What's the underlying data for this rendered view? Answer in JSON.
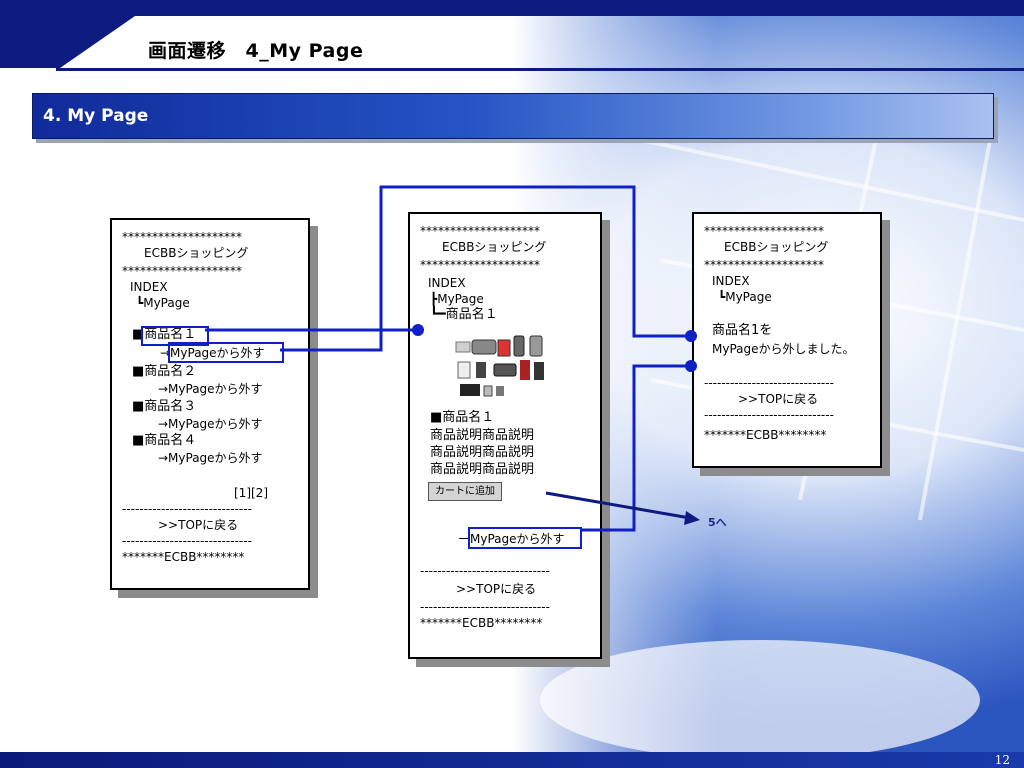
{
  "slide": {
    "title": "画面遷移　4_My Page",
    "section_title": "4. My Page",
    "page_number": "12"
  },
  "screen1": {
    "lines": [
      "********************",
      "ECBBショッピング",
      "********************",
      "INDEX",
      "┗MyPage",
      "■商品名１",
      "　→MyPageから外す",
      "■商品名２",
      "→MyPageから外す",
      "■商品名３",
      "→MyPageから外す",
      "■商品名４",
      "→MyPageから外す",
      "[1][2]",
      "------------------------------",
      ">>TOPに戻る",
      "------------------------------",
      "*******ECBB********"
    ]
  },
  "screen2": {
    "lines": [
      "********************",
      "ECBBショッピング",
      "********************",
      "INDEX",
      "┣MyPage",
      "┗━商品名１",
      "■商品名１",
      "商品説明商品説明",
      "商品説明商品説明",
      "商品説明商品説明",
      "ーMyPageから外す",
      "------------------------------",
      ">>TOPに戻る",
      "------------------------------",
      "*******ECBB********"
    ],
    "cart_button": "カートに追加"
  },
  "screen3": {
    "lines": [
      "********************",
      "ECBBショッピング",
      "********************",
      "INDEX",
      "┗MyPage",
      "商品名1を",
      "MyPageから外しました。",
      "------------------------------",
      ">>TOPに戻る",
      "------------------------------",
      "*******ECBB********"
    ]
  },
  "arrow_label": "5へ",
  "colors": {
    "navy": "#0d1a80",
    "link_blue": "#1020c8"
  }
}
